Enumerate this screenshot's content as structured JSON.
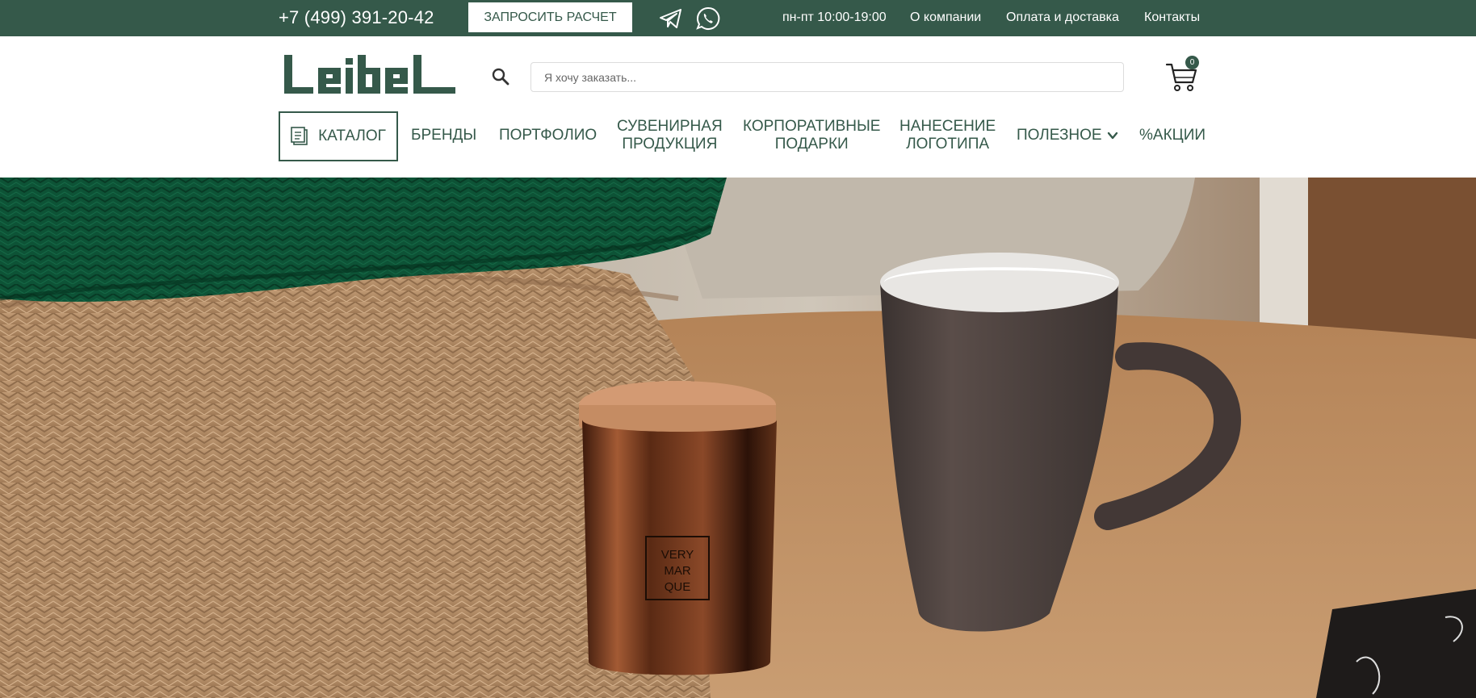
{
  "topbar": {
    "phone": "+7 (499) 391-20-42",
    "request_button": "ЗАПРОСИТЬ РАСЧЕТ",
    "hours": "пн-пт 10:00-19:00",
    "links": [
      "О компании",
      "Оплата и доставка",
      "Контакты"
    ],
    "messengers": [
      "telegram-icon",
      "whatsapp-icon"
    ]
  },
  "header": {
    "logo_text": "LEIBEL",
    "search_placeholder": "Я хочу заказать...",
    "cart_count": "0"
  },
  "menu": {
    "catalog": "КАТАЛОГ",
    "brands": "БРЕНДЫ",
    "portfolio": "ПОРТФОЛИО",
    "souvenir_line1": "СУВЕНИРНАЯ",
    "souvenir_line2": "ПРОДУКЦИЯ",
    "corporate_line1": "КОРПОРАТИВНЫЕ",
    "corporate_line2": "ПОДАРКИ",
    "logo_line1": "НАНЕСЕНИЕ",
    "logo_line2": "ЛОГОТИПА",
    "useful": "ПОЛЕЗНОЕ",
    "sales": "%АКЦИИ"
  },
  "hero": {
    "candle_label_line1": "VERY",
    "candle_label_line2": "MAR",
    "candle_label_line3": "QUE"
  },
  "colors": {
    "brand": "#35594a",
    "white": "#ffffff"
  }
}
